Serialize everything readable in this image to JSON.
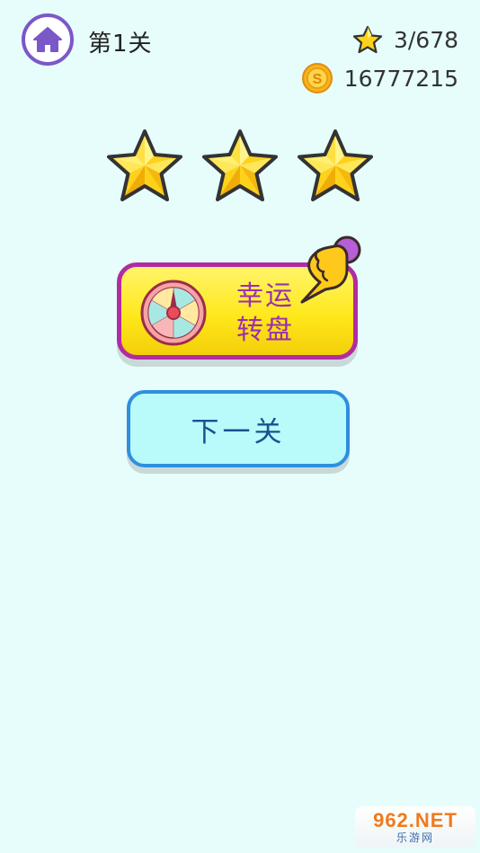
{
  "header": {
    "home_icon": "home-icon",
    "level_title": "第1关",
    "stars_icon": "star-icon",
    "stars_progress": "3/678",
    "coin_icon": "coin-icon",
    "coin_symbol": "S",
    "coins": "16777215"
  },
  "rating": {
    "stars_earned": 3,
    "stars_total": 3
  },
  "lucky_wheel_button": {
    "icon": "wheel-icon",
    "label_line1": "幸运",
    "label_line2": "转盘"
  },
  "pointer_hint": {
    "icon": "pointing-hand-icon"
  },
  "next_level_button": {
    "label": "下一关"
  },
  "watermark": {
    "logo": "962.NET",
    "sub": "乐游网"
  },
  "colors": {
    "background": "#e6fdfc",
    "home_border": "#7b58c8",
    "wheel_button_border": "#b12ca0",
    "wheel_button_fill": "#ffe81c",
    "wheel_label": "#9b2eb0",
    "next_button_border": "#2f8fde",
    "next_button_fill": "#b9fbfb",
    "star_fill": "#ffd21a"
  }
}
